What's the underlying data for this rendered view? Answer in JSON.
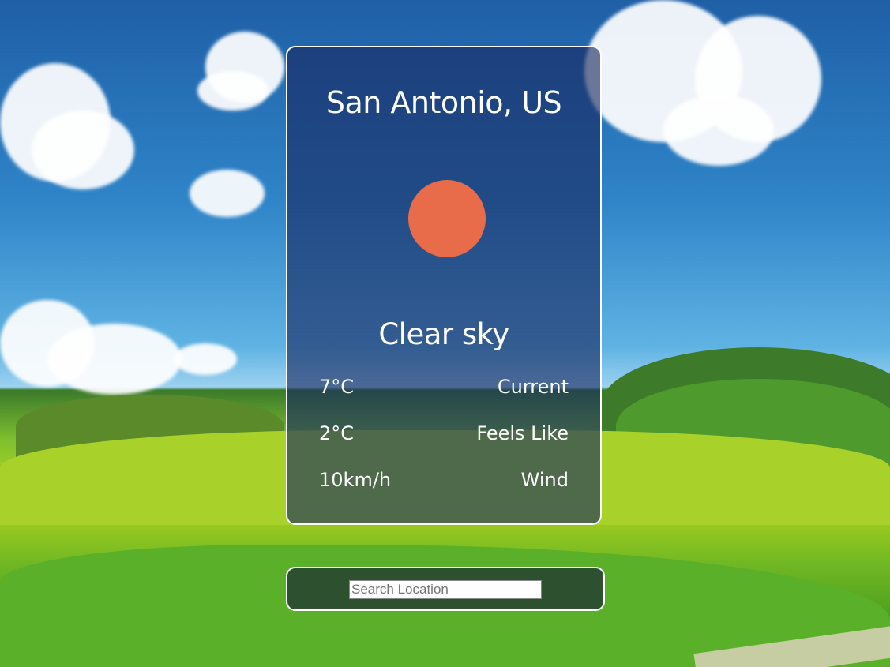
{
  "location": "San Antonio, US",
  "weather": {
    "icon": "sun-icon",
    "description": "Clear sky"
  },
  "stats": [
    {
      "value": "7°C",
      "label": "Current"
    },
    {
      "value": "2°C",
      "label": "Feels Like"
    },
    {
      "value": "10km/h",
      "label": "Wind"
    }
  ],
  "search": {
    "value": "",
    "placeholder": "Search Location"
  },
  "colors": {
    "sun": "#e96c4a",
    "card_border": "#ffffff"
  }
}
